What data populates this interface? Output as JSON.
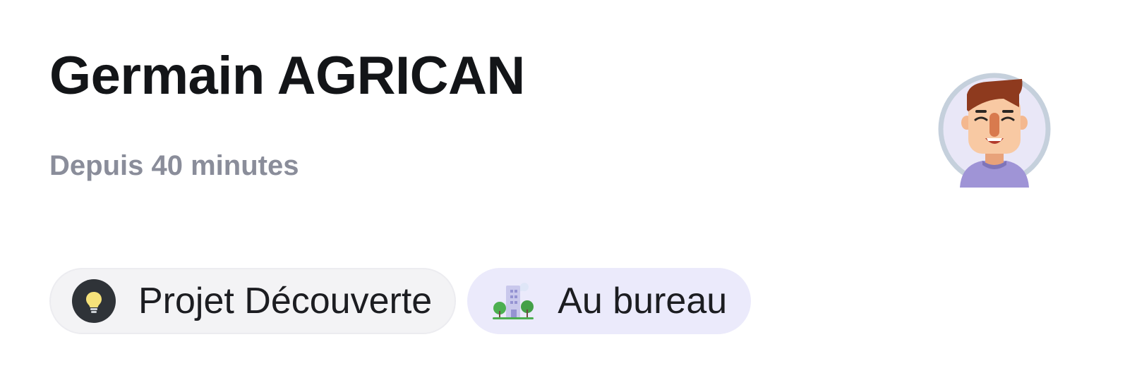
{
  "user": {
    "name": "Germain AGRICAN",
    "since": "Depuis 40 minutes",
    "avatar_icon": "cartoon-man-avatar-icon"
  },
  "tags": [
    {
      "label": "Projet Découverte",
      "icon": "lightbulb-icon",
      "background": "#f3f3f5"
    },
    {
      "label": "Au bureau",
      "icon": "office-building-icon",
      "background": "#ebeafb"
    }
  ],
  "colors": {
    "title": "#131518",
    "subtitle": "#8a8d9a",
    "avatar_ring": "#c5d0dc",
    "avatar_bg": "#e9e7f7",
    "hair": "#8e3a1e",
    "shirt": "#9f94d6"
  }
}
